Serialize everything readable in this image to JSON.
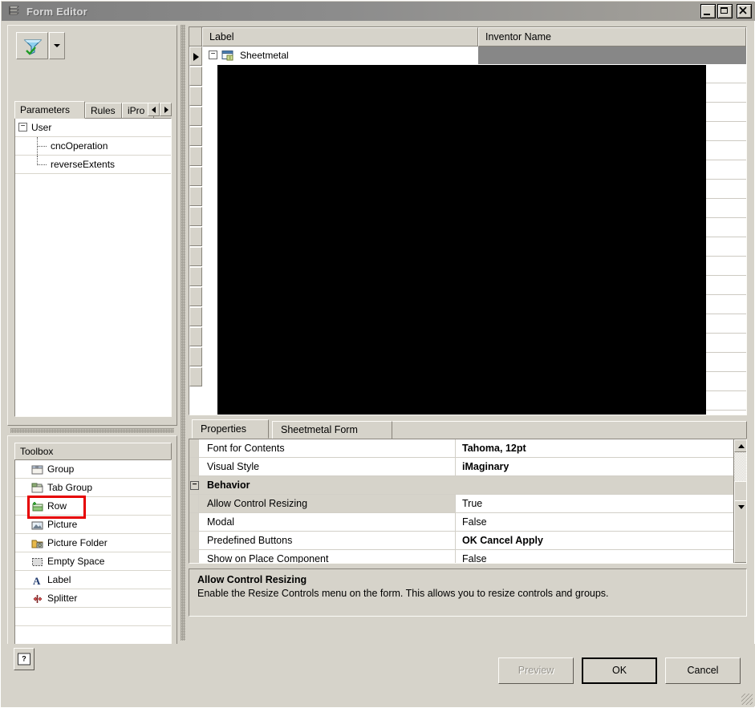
{
  "window": {
    "title": "Form Editor",
    "icon": "form-editor-icon",
    "controls": {
      "minimize": "_",
      "maximize": "□",
      "close": "✕"
    }
  },
  "left_panel": {
    "filter": {
      "icon": "filter-funnel-icon",
      "dropdown_icon": "chevron-down-icon"
    },
    "tabs": [
      {
        "label": "Parameters",
        "active": true
      },
      {
        "label": "Rules",
        "active": false
      },
      {
        "label": "iPro",
        "active": false
      }
    ],
    "tab_scroll": {
      "left": "scroll-left-arrow",
      "right": "scroll-right-arrow"
    },
    "tree": {
      "root": {
        "label": "User",
        "expander": "−"
      },
      "children": [
        {
          "label": "cncOperation"
        },
        {
          "label": "reverseExtents"
        }
      ]
    },
    "toolbox": {
      "header": "Toolbox",
      "items": [
        {
          "label": "Group",
          "icon": "group-icon"
        },
        {
          "label": "Tab Group",
          "icon": "tab-group-icon"
        },
        {
          "label": "Row",
          "icon": "row-icon",
          "highlighted": true
        },
        {
          "label": "Picture",
          "icon": "picture-icon"
        },
        {
          "label": "Picture Folder",
          "icon": "picture-folder-icon"
        },
        {
          "label": "Empty Space",
          "icon": "empty-space-icon"
        },
        {
          "label": "Label",
          "icon": "label-icon"
        },
        {
          "label": "Splitter",
          "icon": "splitter-icon"
        }
      ]
    }
  },
  "form_designer": {
    "columns": [
      {
        "label": "Label"
      },
      {
        "label": "Inventor Name"
      }
    ],
    "rows": [
      {
        "label": "Sheetmetal",
        "inventor_name": "",
        "expander": "−",
        "icon": "form-node-icon",
        "selected": true
      }
    ]
  },
  "properties": {
    "tabs": [
      {
        "label": "Properties",
        "active": true
      },
      {
        "label": "Sheetmetal Form",
        "active": false
      }
    ],
    "rows": [
      {
        "name": "Font for Contents",
        "value": "Tahoma, 12pt",
        "bold": true,
        "category": false,
        "selected": false
      },
      {
        "name": "Visual Style",
        "value": "iMaginary",
        "bold": true,
        "category": false,
        "selected": false
      },
      {
        "name": "Behavior",
        "value": "",
        "bold": true,
        "category": true,
        "expander": "−",
        "selected": false
      },
      {
        "name": "Allow Control Resizing",
        "value": "True",
        "bold": false,
        "category": false,
        "selected": true
      },
      {
        "name": "Modal",
        "value": "False",
        "bold": false,
        "category": false,
        "selected": false
      },
      {
        "name": "Predefined Buttons",
        "value": "OK Cancel Apply",
        "bold": true,
        "category": false,
        "selected": false
      },
      {
        "name": "Show on Place Component",
        "value": "False",
        "bold": false,
        "category": false,
        "selected": false
      }
    ],
    "description": {
      "title": "Allow Control Resizing",
      "text": "Enable the Resize Controls menu on the form.  This allows you to resize controls and groups."
    },
    "scrollbar": {
      "up": "scroll-up-arrow",
      "down": "scroll-down-arrow"
    }
  },
  "footer": {
    "help": {
      "icon": "help-question-icon",
      "label": "?"
    },
    "buttons": [
      {
        "label": "Preview",
        "disabled": true,
        "default": false
      },
      {
        "label": "OK",
        "disabled": false,
        "default": true
      },
      {
        "label": "Cancel",
        "disabled": false,
        "default": false
      }
    ]
  },
  "colors": {
    "face": "#d6d3ca",
    "titlebar": "#8c8c8c",
    "highlight_red": "#e60000",
    "selection_gray": "#878787",
    "canvas_black": "#000000"
  }
}
